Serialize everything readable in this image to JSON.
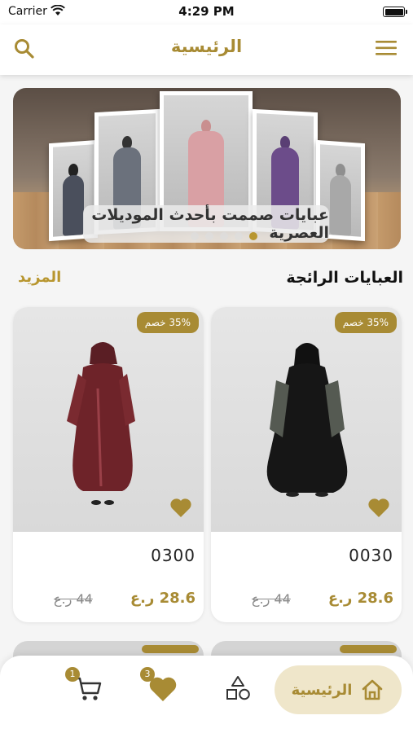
{
  "status_bar": {
    "carrier": "Carrier",
    "time": "4:29 PM"
  },
  "header": {
    "title": "الرئيسية",
    "search_icon": "search-icon",
    "menu_icon": "hamburger-menu-icon"
  },
  "banner": {
    "caption": "عبايات صممت بأحدث الموديلات العصرية",
    "dots_count": 5,
    "active_dot": 5
  },
  "section": {
    "title": "العبايات الرائجة",
    "more_label": "المزيد"
  },
  "products": [
    {
      "name": "0030",
      "price": "28.6 ر.ع",
      "old_price": "44 ر.ع",
      "discount": "35% خصم"
    },
    {
      "name": "0300",
      "price": "28.6 ر.ع",
      "old_price": "44 ر.ع",
      "discount": "35% خصم"
    }
  ],
  "bottom_nav": {
    "home_label": "الرئيسية",
    "favorites_badge": "3",
    "cart_badge": "1"
  },
  "colors": {
    "accent": "#a88b34",
    "accent_light": "#efe6ca"
  }
}
